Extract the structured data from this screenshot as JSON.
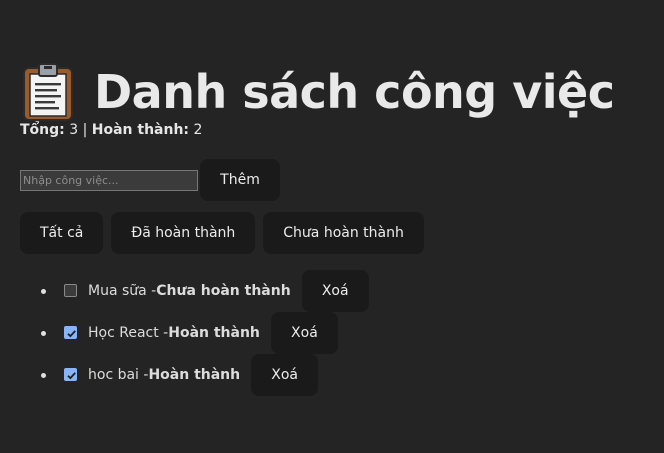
{
  "header": {
    "title": "Danh sách công việc",
    "icon": "clipboard-icon"
  },
  "stats": {
    "total_label": "Tổng:",
    "total_value": "3",
    "separator": "|",
    "done_label": "Hoàn thành:",
    "done_value": "2"
  },
  "add_form": {
    "input_value": "",
    "placeholder": "Nhập công việc...",
    "add_label": "Thêm"
  },
  "filters": [
    {
      "label": "Tất cả"
    },
    {
      "label": "Đã hoàn thành"
    },
    {
      "label": "Chưa hoàn thành"
    }
  ],
  "todos": [
    {
      "text": "Mua sữa -",
      "status": "Chưa hoàn thành",
      "done": false,
      "delete_label": "Xoá"
    },
    {
      "text": "Học React -",
      "status": "Hoàn thành",
      "done": true,
      "delete_label": "Xoá"
    },
    {
      "text": "hoc bai -",
      "status": "Hoàn thành",
      "done": true,
      "delete_label": "Xoá"
    }
  ],
  "colors": {
    "background": "#242424",
    "button_bg": "#1a1a1a",
    "checkbox_checked": "#8ab4f8"
  }
}
